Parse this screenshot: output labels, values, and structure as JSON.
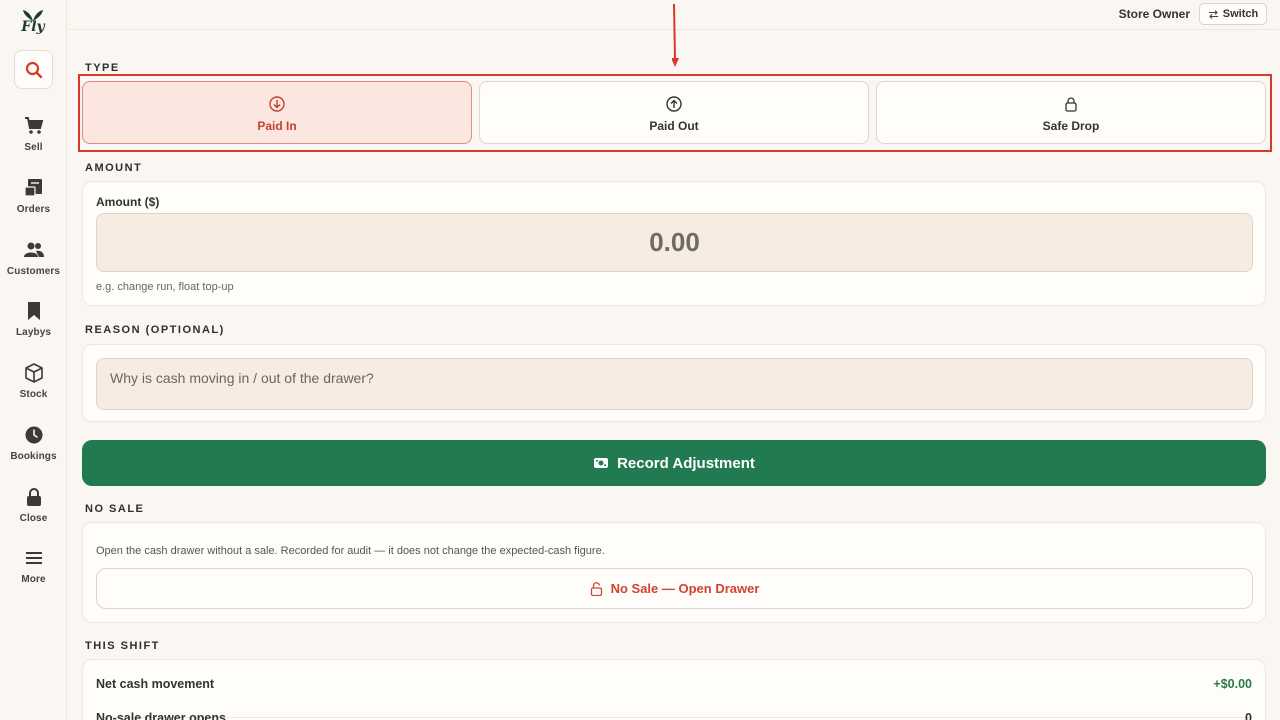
{
  "app": {
    "logo_text": "Fly"
  },
  "sidebar": {
    "items": [
      {
        "label": "Sell",
        "icon": "cart-icon"
      },
      {
        "label": "Orders",
        "icon": "receipt-icon"
      },
      {
        "label": "Customers",
        "icon": "users-icon"
      },
      {
        "label": "Laybys",
        "icon": "bookmark-icon"
      },
      {
        "label": "Stock",
        "icon": "box-icon"
      },
      {
        "label": "Bookings",
        "icon": "clock-icon"
      },
      {
        "label": "Close",
        "icon": "lock-icon"
      },
      {
        "label": "More",
        "icon": "menu-icon"
      }
    ]
  },
  "header": {
    "role": "Store Owner",
    "switch_label": "Switch"
  },
  "type_section": {
    "title": "TYPE",
    "options": [
      {
        "label": "Paid In",
        "icon": "arrow-down-circle-icon",
        "selected": true
      },
      {
        "label": "Paid Out",
        "icon": "arrow-up-circle-icon",
        "selected": false
      },
      {
        "label": "Safe Drop",
        "icon": "lock-icon",
        "selected": false
      }
    ]
  },
  "amount_section": {
    "title": "AMOUNT",
    "field_label": "Amount ($)",
    "value": "0.00",
    "hint": "e.g. change run, float top-up"
  },
  "reason_section": {
    "title": "REASON (OPTIONAL)",
    "placeholder": "Why is cash moving in / out of the drawer?"
  },
  "record_button": {
    "label": "Record Adjustment"
  },
  "no_sale_section": {
    "title": "NO SALE",
    "description": "Open the cash drawer without a sale. Recorded for audit — it does not change the expected-cash figure.",
    "button_label": "No Sale — Open Drawer"
  },
  "shift_section": {
    "title": "THIS SHIFT",
    "rows": [
      {
        "label": "Net cash movement",
        "value": "+$0.00"
      },
      {
        "label": "No-sale drawer opens",
        "value": "0"
      }
    ]
  },
  "colors": {
    "primary_green": "#217a50",
    "accent_red": "#d0442f",
    "highlight_red": "#d8392b",
    "background": "#faf7f2"
  }
}
